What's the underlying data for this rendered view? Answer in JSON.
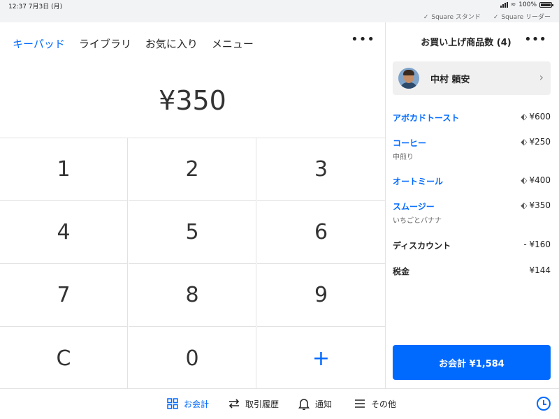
{
  "status_bar": {
    "time_date": "12:37  7月3日 (月)",
    "battery": "100%",
    "checks": [
      "Square スタンド",
      "Square リーダー"
    ]
  },
  "tabs": [
    {
      "label": "キーパッド",
      "active": true
    },
    {
      "label": "ライブラリ",
      "active": false
    },
    {
      "label": "お気に入り",
      "active": false
    },
    {
      "label": "メニュー",
      "active": false
    }
  ],
  "amount": "¥350",
  "keypad": [
    "1",
    "2",
    "3",
    "4",
    "5",
    "6",
    "7",
    "8",
    "9",
    "C",
    "0",
    "+"
  ],
  "cart": {
    "title": "お買い上げ商品数 (4)",
    "customer": "中村 頼安",
    "items": [
      {
        "name": "アボカドトースト",
        "sub": "",
        "price": "¥600"
      },
      {
        "name": "コーヒー",
        "sub": "中煎り",
        "price": "¥250"
      },
      {
        "name": "オートミール",
        "sub": "",
        "price": "¥400"
      },
      {
        "name": "スムージー",
        "sub": "いちごとバナナ",
        "price": "¥350"
      }
    ],
    "discount_label": "ディスカウント",
    "discount_value": "- ¥160",
    "tax_label": "税金",
    "tax_value": "¥144",
    "checkout_label": "お会計 ¥1,584"
  },
  "bottom_nav": [
    {
      "label": "お会計",
      "icon": "grid-icon",
      "active": true
    },
    {
      "label": "取引履歴",
      "icon": "swap-arrows-icon",
      "active": false
    },
    {
      "label": "通知",
      "icon": "bell-icon",
      "active": false
    },
    {
      "label": "その他",
      "icon": "menu-icon",
      "active": false
    }
  ],
  "colors": {
    "accent": "#006aff"
  }
}
